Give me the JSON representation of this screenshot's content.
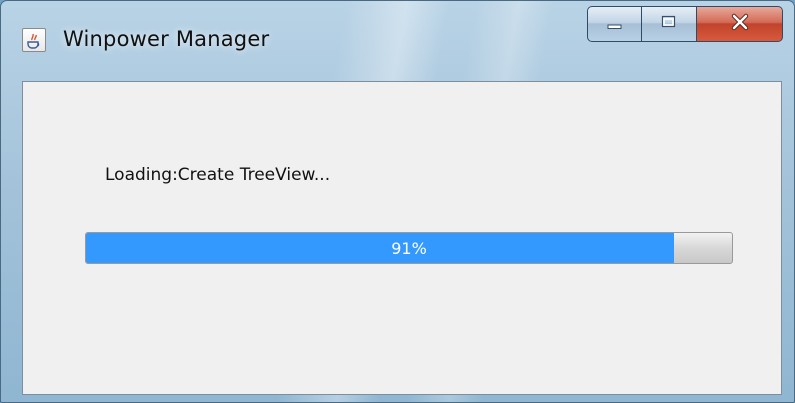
{
  "window": {
    "title": "Winpower Manager",
    "app_icon": "java-cup-icon",
    "caption_buttons": {
      "minimize_icon": "minimize-icon",
      "maximize_icon": "maximize-icon",
      "close_icon": "close-icon"
    }
  },
  "loader": {
    "status_text": "Loading:Create TreeView...",
    "progress_fraction": 0.91,
    "progress_label": "91%"
  },
  "colors": {
    "progress_fill": "#3399ff",
    "close_button": "#c0432b",
    "client_background": "#f0f0f0"
  }
}
